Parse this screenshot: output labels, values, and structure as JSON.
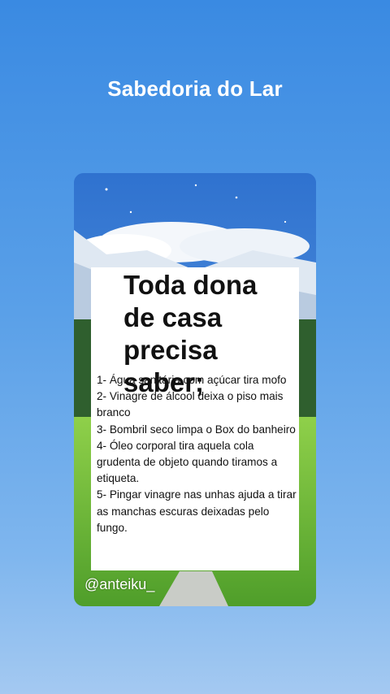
{
  "header": {
    "title": "Sabedoria do Lar"
  },
  "post": {
    "headline": "Toda dona de casa precisa saber;",
    "tips": [
      "1- Água sanitária com açúcar tira mofo",
      "2- Vinagre de álcool deixa o piso mais branco",
      "3- Bombril seco limpa o Box do banheiro",
      "4- Óleo corporal tira aquela cola grudenta de objeto quando tiramos a etiqueta.",
      "5- Pingar vinagre nas unhas ajuda a tirar as manchas escuras deixadas pelo fungo."
    ],
    "watermark": "@anteiku_"
  },
  "colors": {
    "background_top": "#3a8ae2",
    "background_bottom": "#a4c9f1",
    "panel": "#ffffff",
    "grass": "#6bb83a"
  }
}
